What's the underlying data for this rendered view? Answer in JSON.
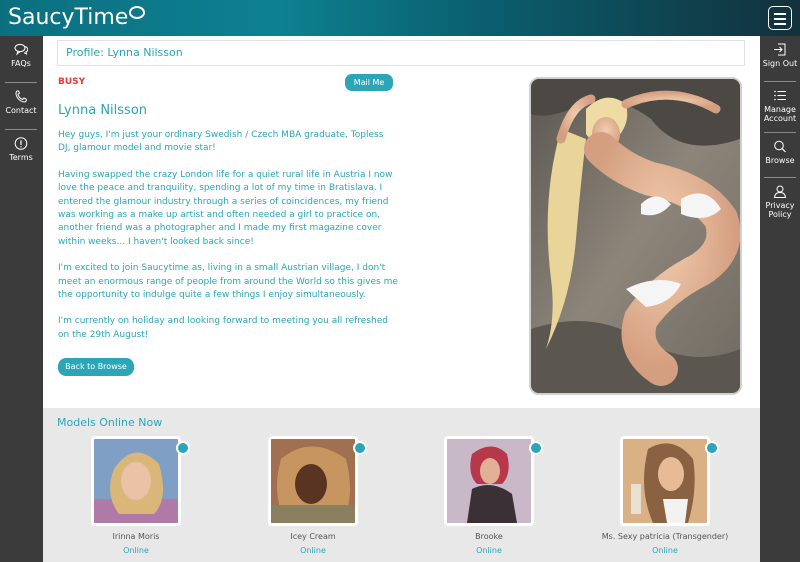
{
  "brand": {
    "logo_text": "SaucyTime"
  },
  "left_nav": [
    {
      "label": "FAQs",
      "icon": "chat-bubbles-icon"
    },
    {
      "label": "Contact",
      "icon": "phone-icon"
    },
    {
      "label": "Terms",
      "icon": "info-icon"
    }
  ],
  "right_nav": [
    {
      "label": "Sign Out",
      "icon": "sign-out-icon"
    },
    {
      "label": "Manage Account",
      "icon": "list-icon"
    },
    {
      "label": "Browse",
      "icon": "search-icon"
    },
    {
      "label": "Privacy Policy",
      "icon": "user-icon"
    }
  ],
  "profile": {
    "title": "Profile: Lynna Nilsson",
    "status": "BUSY",
    "mail_button": "Mail Me",
    "name": "Lynna Nilsson",
    "bio": [
      "Hey guys, I'm just your ordinary Swedish / Czech MBA graduate, Topless DJ, glamour model and movie star!",
      "Having swapped the crazy London life for a quiet rural life in Austria I now love the peace and tranquility, spending a lot of my time in Bratislava. I entered the glamour industry through a series of coincidences, my friend was working as a make up artist and often needed a girl to practice on, another friend was a photographer and I made my first magazine cover within weeks... I haven't looked back since!",
      "I'm excited to join Saucytime as, living in a small Austrian village, I don't meet an enormous range of people from around the World so this gives me the opportunity to indulge quite a few things I enjoy simultaneously.",
      "I'm currently on holiday and looking forward to meeting you all refreshed on the 29th August!"
    ],
    "back_button": "Back to Browse"
  },
  "models_online": {
    "title": "Models Online Now",
    "models": [
      {
        "name": "Irinna Moris",
        "status": "Online"
      },
      {
        "name": "Icey Cream",
        "status": "Online"
      },
      {
        "name": "Brooke",
        "status": "Online"
      },
      {
        "name": "Ms. Sexy patricia (Transgender)",
        "status": "Online"
      }
    ]
  },
  "colors": {
    "accent": "#2aa6b8",
    "busy": "#e63a3a",
    "sidebar": "#3b3b3b"
  }
}
